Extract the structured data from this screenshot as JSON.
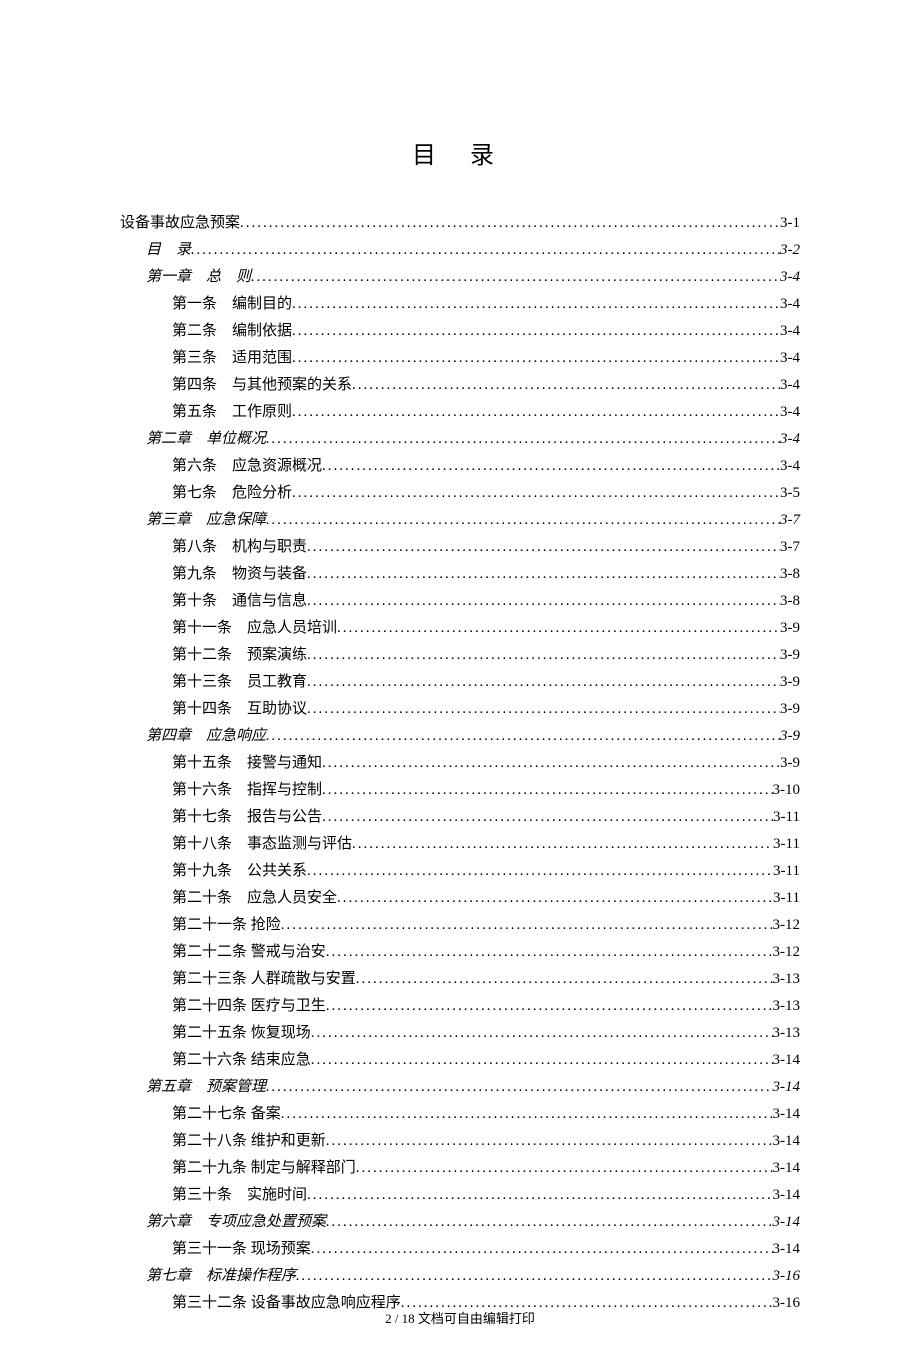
{
  "title": "目 录",
  "toc": [
    {
      "label": "设备事故应急预案",
      "page": "3-1",
      "indent": 0,
      "italic": false
    },
    {
      "label": "目　录",
      "page": "3-2",
      "indent": 1,
      "italic": true
    },
    {
      "label": "第一章　总　则",
      "page": "3-4",
      "indent": 1,
      "italic": true
    },
    {
      "label": "第一条　编制目的",
      "page": "3-4",
      "indent": 2,
      "italic": false
    },
    {
      "label": "第二条　编制依据",
      "page": "3-4",
      "indent": 2,
      "italic": false
    },
    {
      "label": "第三条　适用范围",
      "page": "3-4",
      "indent": 2,
      "italic": false
    },
    {
      "label": "第四条　与其他预案的关系",
      "page": "3-4",
      "indent": 2,
      "italic": false
    },
    {
      "label": "第五条　工作原则",
      "page": "3-4",
      "indent": 2,
      "italic": false
    },
    {
      "label": "第二章　单位概况",
      "page": "3-4",
      "indent": 1,
      "italic": true
    },
    {
      "label": "第六条　应急资源概况",
      "page": "3-4",
      "indent": 2,
      "italic": false
    },
    {
      "label": "第七条　危险分析",
      "page": "3-5",
      "indent": 2,
      "italic": false
    },
    {
      "label": "第三章　应急保障",
      "page": "3-7",
      "indent": 1,
      "italic": true
    },
    {
      "label": "第八条　机构与职责",
      "page": "3-7",
      "indent": 2,
      "italic": false
    },
    {
      "label": "第九条　物资与装备",
      "page": "3-8",
      "indent": 2,
      "italic": false
    },
    {
      "label": "第十条　通信与信息",
      "page": "3-8",
      "indent": 2,
      "italic": false
    },
    {
      "label": "第十一条　应急人员培训",
      "page": "3-9",
      "indent": 2,
      "italic": false
    },
    {
      "label": "第十二条　预案演练",
      "page": "3-9",
      "indent": 2,
      "italic": false
    },
    {
      "label": "第十三条　员工教育",
      "page": "3-9",
      "indent": 2,
      "italic": false
    },
    {
      "label": "第十四条　互助协议",
      "page": "3-9",
      "indent": 2,
      "italic": false
    },
    {
      "label": "第四章　应急响应",
      "page": "3-9",
      "indent": 1,
      "italic": true
    },
    {
      "label": "第十五条　接警与通知",
      "page": "3-9",
      "indent": 2,
      "italic": false
    },
    {
      "label": "第十六条　指挥与控制",
      "page": "3-10",
      "indent": 2,
      "italic": false
    },
    {
      "label": "第十七条　报告与公告",
      "page": "3-11",
      "indent": 2,
      "italic": false
    },
    {
      "label": "第十八条　事态监测与评估",
      "page": "3-11",
      "indent": 2,
      "italic": false
    },
    {
      "label": "第十九条　公共关系",
      "page": "3-11",
      "indent": 2,
      "italic": false
    },
    {
      "label": "第二十条　应急人员安全",
      "page": "3-11",
      "indent": 2,
      "italic": false
    },
    {
      "label": "第二十一条 抢险",
      "page": "3-12",
      "indent": 2,
      "italic": false
    },
    {
      "label": "第二十二条 警戒与治安",
      "page": "3-12",
      "indent": 2,
      "italic": false
    },
    {
      "label": "第二十三条 人群疏散与安置",
      "page": "3-13",
      "indent": 2,
      "italic": false
    },
    {
      "label": "第二十四条 医疗与卫生",
      "page": "3-13",
      "indent": 2,
      "italic": false
    },
    {
      "label": "第二十五条 恢复现场",
      "page": "3-13",
      "indent": 2,
      "italic": false
    },
    {
      "label": "第二十六条 结束应急",
      "page": "3-14",
      "indent": 2,
      "italic": false
    },
    {
      "label": "第五章　预案管理",
      "page": "3-14",
      "indent": 1,
      "italic": true
    },
    {
      "label": "第二十七条 备案",
      "page": "3-14",
      "indent": 2,
      "italic": false
    },
    {
      "label": "第二十八条 维护和更新",
      "page": "3-14",
      "indent": 2,
      "italic": false
    },
    {
      "label": "第二十九条 制定与解释部门",
      "page": "3-14",
      "indent": 2,
      "italic": false
    },
    {
      "label": "第三十条　实施时间",
      "page": "3-14",
      "indent": 2,
      "italic": false
    },
    {
      "label": "第六章　专项应急处置预案",
      "page": "3-14",
      "indent": 1,
      "italic": true
    },
    {
      "label": "第三十一条 现场预案",
      "page": "3-14",
      "indent": 2,
      "italic": false
    },
    {
      "label": "第七章　标准操作程序",
      "page": "3-16",
      "indent": 1,
      "italic": true
    },
    {
      "label": "第三十二条 设备事故应急响应程序",
      "page": "3-16",
      "indent": 2,
      "italic": false
    }
  ],
  "footer": "2 / 18 文档可自由编辑打印"
}
